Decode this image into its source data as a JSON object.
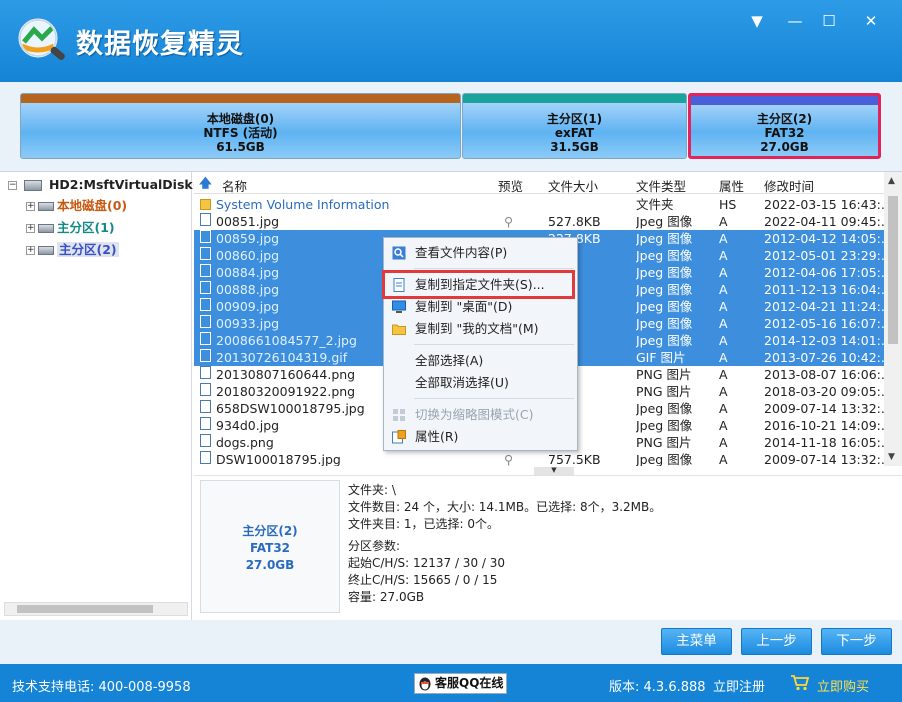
{
  "app": {
    "title": "数据恢复精灵"
  },
  "window_controls": {
    "dropdown": "▼",
    "minimize": "—",
    "maximize": "☐",
    "close": "✕"
  },
  "partitions": [
    {
      "name": "本地磁盘(0)",
      "fs": "NTFS (活动)",
      "size": "61.5GB",
      "color": "#b5651d",
      "selected": false
    },
    {
      "name": "主分区(1)",
      "fs": "exFAT",
      "size": "31.5GB",
      "color": "#1aa39a",
      "selected": false
    },
    {
      "name": "主分区(2)",
      "fs": "FAT32",
      "size": "27.0GB",
      "color": "#4a5fd8",
      "selected": true
    }
  ],
  "tree": {
    "disk": "HD2:MsftVirtualDisk(1",
    "items": [
      {
        "label": "本地磁盘(0)",
        "color": "#c75a12"
      },
      {
        "label": "主分区(1)",
        "color": "#138a82"
      },
      {
        "label": "主分区(2)",
        "color": "#3b4fc7"
      }
    ]
  },
  "list": {
    "columns": {
      "name": "名称",
      "preview": "预览",
      "size": "文件大小",
      "type": "文件类型",
      "attr": "属性",
      "mtime": "修改时间"
    },
    "rows": [
      {
        "name": "System Volume Information",
        "size": "",
        "type": "文件夹",
        "attr": "HS",
        "mtime": "2022-03-15 16:43:...",
        "folder": true,
        "selected": false,
        "preview": false
      },
      {
        "name": "00851.jpg",
        "size": "527.8KB",
        "type": "Jpeg 图像",
        "attr": "A",
        "mtime": "2022-04-11 09:45:...",
        "selected": false,
        "preview": true
      },
      {
        "name": "00859.jpg",
        "size": "227.8KB",
        "type": "Jpeg 图像",
        "attr": "A",
        "mtime": "2012-04-12 14:05:...",
        "selected": true
      },
      {
        "name": "00860.jpg",
        "size": "KB",
        "type": "Jpeg 图像",
        "attr": "A",
        "mtime": "2012-05-01 23:29:...",
        "selected": true
      },
      {
        "name": "00884.jpg",
        "size": "KB",
        "type": "Jpeg 图像",
        "attr": "A",
        "mtime": "2012-04-06 17:05:...",
        "selected": true
      },
      {
        "name": "00888.jpg",
        "size": "KB",
        "type": "Jpeg 图像",
        "attr": "A",
        "mtime": "2011-12-13 16:04:...",
        "selected": true
      },
      {
        "name": "00909.jpg",
        "size": "KB",
        "type": "Jpeg 图像",
        "attr": "A",
        "mtime": "2012-04-21 11:24:...",
        "selected": true
      },
      {
        "name": "00933.jpg",
        "size": "B",
        "type": "Jpeg 图像",
        "attr": "A",
        "mtime": "2012-05-16 16:07:...",
        "selected": true
      },
      {
        "name": "2008661084577_2.jpg",
        "size": "KB",
        "type": "Jpeg 图像",
        "attr": "A",
        "mtime": "2014-12-03 14:01:...",
        "selected": true
      },
      {
        "name": "20130726104319.gif",
        "size": "KB",
        "type": "GIF 图片",
        "attr": "A",
        "mtime": "2013-07-26 10:42:...",
        "selected": true
      },
      {
        "name": "20130807160644.png",
        "size": "KB",
        "type": "PNG 图片",
        "attr": "A",
        "mtime": "2013-08-07 16:06:...",
        "selected": false
      },
      {
        "name": "20180320091922.png",
        "size": "KB",
        "type": "PNG 图片",
        "attr": "A",
        "mtime": "2018-03-20 09:05:...",
        "selected": false
      },
      {
        "name": "658DSW100018795.jpg",
        "size": "KB",
        "type": "Jpeg 图像",
        "attr": "A",
        "mtime": "2009-07-14 13:32:...",
        "selected": false
      },
      {
        "name": "934d0.jpg",
        "size": "KB",
        "type": "Jpeg 图像",
        "attr": "A",
        "mtime": "2016-10-21 14:09:...",
        "selected": false
      },
      {
        "name": "dogs.png",
        "size": "B",
        "type": "PNG 图片",
        "attr": "A",
        "mtime": "2014-11-18 16:05:...",
        "selected": false
      },
      {
        "name": "DSW100018795.jpg",
        "size": "757.5KB",
        "type": "Jpeg 图像",
        "attr": "A",
        "mtime": "2009-07-14 13:32:...",
        "selected": false,
        "preview": true
      }
    ]
  },
  "context_menu": {
    "items": [
      {
        "label": "查看文件内容(P)",
        "icon": "view-icon",
        "disabled": false
      },
      {
        "label": "复制到指定文件夹(S)...",
        "icon": "copy-folder-icon",
        "disabled": false,
        "highlighted": true
      },
      {
        "label": "复制到 \"桌面\"(D)",
        "icon": "desktop-icon",
        "disabled": false
      },
      {
        "label": "复制到 \"我的文档\"(M)",
        "icon": "documents-icon",
        "disabled": false
      },
      {
        "label": "全部选择(A)",
        "icon": "",
        "disabled": false
      },
      {
        "label": "全部取消选择(U)",
        "icon": "",
        "disabled": false
      },
      {
        "label": "切换为缩略图模式(C)",
        "icon": "thumbnail-icon",
        "disabled": true
      },
      {
        "label": "属性(R)",
        "icon": "properties-icon",
        "disabled": false
      }
    ]
  },
  "info": {
    "box": {
      "name": "主分区(2)",
      "fs": "FAT32",
      "size": "27.0GB"
    },
    "lines": [
      "文件夹: \\",
      "文件数目: 24 个，大小: 14.1MB。已选择: 8个，3.2MB。",
      "文件夹目: 1，已选择: 0个。",
      "",
      "分区参数:",
      "起始C/H/S:    12137 /  30 /  30",
      "终止C/H/S:      15665 /   0 /  15",
      "容量: 27.0GB"
    ]
  },
  "buttons": {
    "main_menu": "主菜单",
    "prev": "上一步",
    "next": "下一步"
  },
  "status": {
    "support": "技术支持电话: 400-008-9958",
    "qq": "客服QQ在线",
    "version": "版本: 4.3.6.888",
    "register": "立即注册",
    "buy": "立即购买"
  }
}
